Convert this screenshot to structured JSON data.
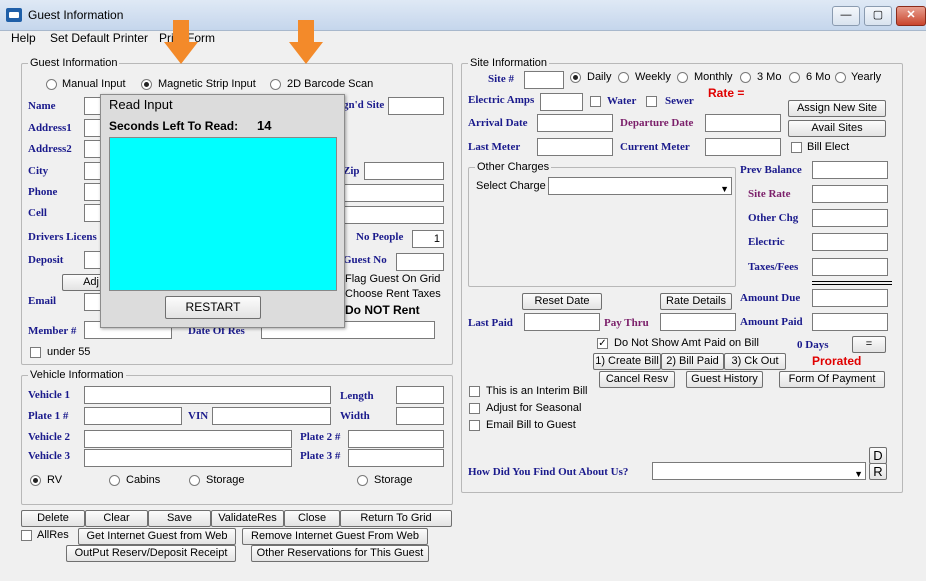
{
  "window": {
    "title": "Guest Information",
    "controls": {
      "minimize": "—",
      "maximize": "▢",
      "close": "✕"
    }
  },
  "menu": [
    "Help",
    "Set Default Printer",
    "Print Form"
  ],
  "guest_info": {
    "legend": "Guest Information",
    "input_modes": {
      "manual": "Manual Input",
      "magnetic": "Magnetic Strip Input",
      "barcode": "2D Barcode Scan",
      "selected": "magnetic"
    },
    "labels": {
      "name": "Name",
      "address1": "Address1",
      "address2": "Address2",
      "city": "City",
      "phone": "Phone",
      "cell": "Cell",
      "drivers_license": "Drivers Licens",
      "deposit": "Deposit",
      "email": "Email",
      "member": "Member #",
      "assigned_site": "gn'd Site",
      "zip": "Zip",
      "no_people": "No People",
      "guest_no": "Guest No",
      "date_of_res": "Date Of Res"
    },
    "values": {
      "no_people": "1"
    },
    "adjust_button": "Adj",
    "flag_guest": "Flag Guest On Grid",
    "choose_rent_taxes": "Choose Rent Taxes",
    "do_not_rent": "Do NOT Rent",
    "under55": "under 55"
  },
  "read_input": {
    "title": "Read  Input",
    "seconds_label": "Seconds Left To Read:",
    "seconds_value": "14",
    "restart": "RESTART",
    "card_color": "#00ffff"
  },
  "vehicle_info": {
    "legend": "Vehicle Information",
    "labels": {
      "vehicle1": "Vehicle 1",
      "plate1": "Plate 1 #",
      "vin": "VIN",
      "vehicle2": "Vehicle 2",
      "vehicle3": "Vehicle 3",
      "length": "Length",
      "width": "Width",
      "plate2": "Plate 2 #",
      "plate3": "Plate 3 #"
    },
    "types": {
      "rv": "RV",
      "cabins": "Cabins",
      "storage1": "Storage",
      "storage2": "Storage",
      "selected": "rv"
    }
  },
  "bottom_buttons": {
    "delete": "Delete",
    "clear": "Clear",
    "save": "Save",
    "validate": "ValidateRes",
    "close": "Close",
    "return_grid": "Return To Grid",
    "all_res": "AllRes",
    "get_internet": "Get Internet Guest from Web",
    "remove_internet": "Remove Internet Guest From Web",
    "output_receipt": "OutPut Reserv/Deposit Receipt",
    "other_res": "Other Reservations for This Guest"
  },
  "site_info": {
    "legend": "Site Information",
    "labels": {
      "site": "Site #",
      "electric_amps": "Electric Amps",
      "water": "Water",
      "sewer": "Sewer",
      "arrival": "Arrival Date",
      "departure": "Departure Date",
      "last_meter": "Last Meter",
      "current_meter": "Current Meter",
      "bill_elect": "Bill Elect",
      "rate": "Rate ="
    },
    "periods": {
      "daily": "Daily",
      "weekly": "Weekly",
      "monthly": "Monthly",
      "three_mo": "3 Mo",
      "six_mo": "6 Mo",
      "yearly": "Yearly",
      "selected": "daily"
    },
    "buttons": {
      "assign_new_site": "Assign New Site",
      "avail_sites": "Avail Sites"
    },
    "other_charges": {
      "legend": "Other Charges",
      "select_label": "Select Charge"
    },
    "totals": {
      "prev_balance": "Prev Balance",
      "site_rate": "Site Rate",
      "other_chg": "Other Chg",
      "electric": "Electric",
      "taxes_fees": "Taxes/Fees",
      "amount_due": "Amount Due",
      "amount_paid": "Amount Paid"
    },
    "reset_date": "Reset Date",
    "rate_details": "Rate Details",
    "last_paid": "Last Paid",
    "pay_thru": "Pay Thru",
    "do_not_show": "Do Not Show Amt Paid on Bill",
    "days": "0 Days",
    "equals": "=",
    "create_bill": "1) Create Bill",
    "bill_paid": "2) Bill Paid",
    "ck_out": "3) Ck Out",
    "prorated": "Prorated",
    "cancel_resv": "Cancel Resv",
    "guest_history": "Guest History",
    "form_of_payment": "Form Of Payment",
    "interim_bill": "This is an Interim Bill",
    "adjust_seasonal": "Adjust for Seasonal",
    "email_bill": "Email Bill to Guest",
    "how_found": "How Did You Find Out About Us?",
    "d_button": "D",
    "r_button": "R"
  }
}
